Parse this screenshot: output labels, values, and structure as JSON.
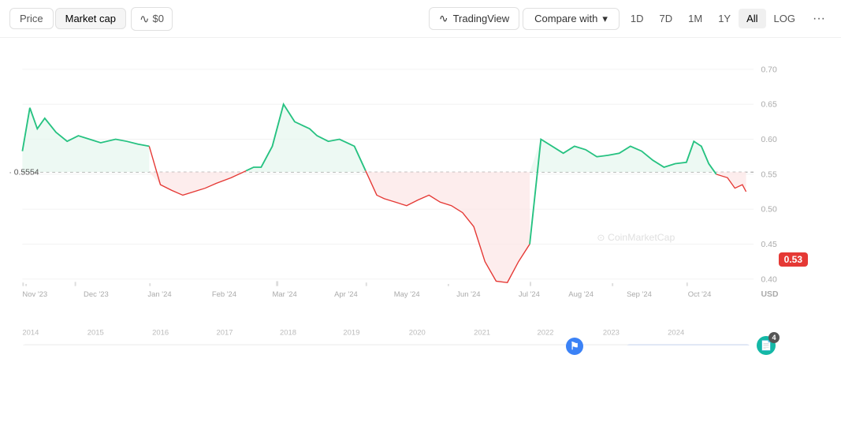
{
  "toolbar": {
    "price_label": "Price",
    "market_cap_label": "Market cap",
    "chart_icon": "∿",
    "price_icon": "$0",
    "tradingview_label": "TradingView",
    "compare_label": "Compare with",
    "periods": [
      "1D",
      "7D",
      "1M",
      "1Y",
      "All",
      "LOG"
    ],
    "active_period": "All",
    "more_icon": "···"
  },
  "chart": {
    "ref_value": "0.5554",
    "current_value": "0.53",
    "currency": "USD",
    "watermark": "CoinMarketCap",
    "x_labels": [
      "Nov '23",
      "Dec '23",
      "Jan '24",
      "Feb '24",
      "Mar '24",
      "Apr '24",
      "May '24",
      "Jun '24",
      "Jul '24",
      "Aug '24",
      "Sep '24",
      "Oct '24"
    ],
    "y_labels": [
      "0.70",
      "0.65",
      "0.60",
      "0.55",
      "0.50",
      "0.45",
      "0.40"
    ],
    "year_labels": [
      "2014",
      "2015",
      "2016",
      "2017",
      "2018",
      "2019",
      "2020",
      "2021",
      "2022",
      "2023",
      "2024"
    ],
    "annotation_flag": "⚑",
    "annotation_doc": "📄",
    "annotation_count": "4"
  }
}
